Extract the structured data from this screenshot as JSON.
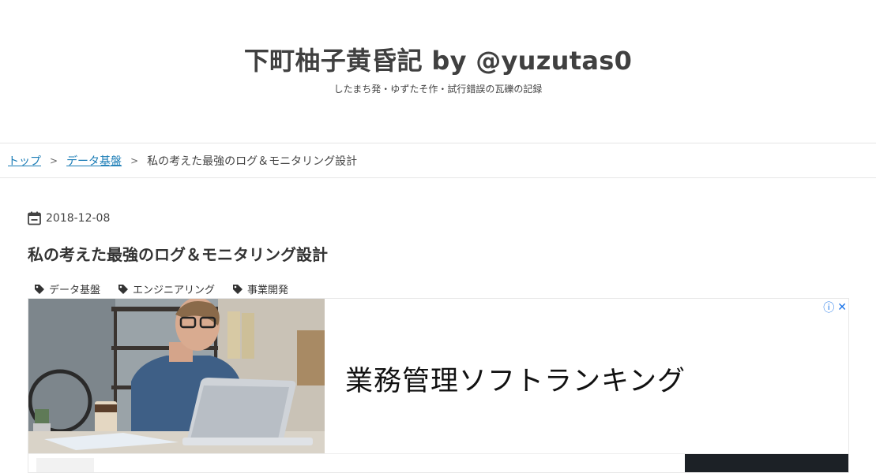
{
  "header": {
    "title": "下町柚子黄昏記 by @yuzutas0",
    "description": "したまち発・ゆずたそ作・試行錯誤の瓦礫の記録"
  },
  "breadcrumb": {
    "items": [
      {
        "label": "トップ"
      },
      {
        "label": "データ基盤"
      }
    ],
    "separator": ">",
    "current": "私の考えた最強のログ＆モニタリング設計"
  },
  "post": {
    "date": "2018-12-08",
    "title": "私の考えた最強のログ＆モニタリング設計",
    "tags": [
      "データ基盤",
      "エンジニアリング",
      "事業開発"
    ]
  },
  "ad": {
    "headline": "業務管理ソフトランキング",
    "info_icon": "info-icon",
    "close_icon": "close-icon"
  }
}
